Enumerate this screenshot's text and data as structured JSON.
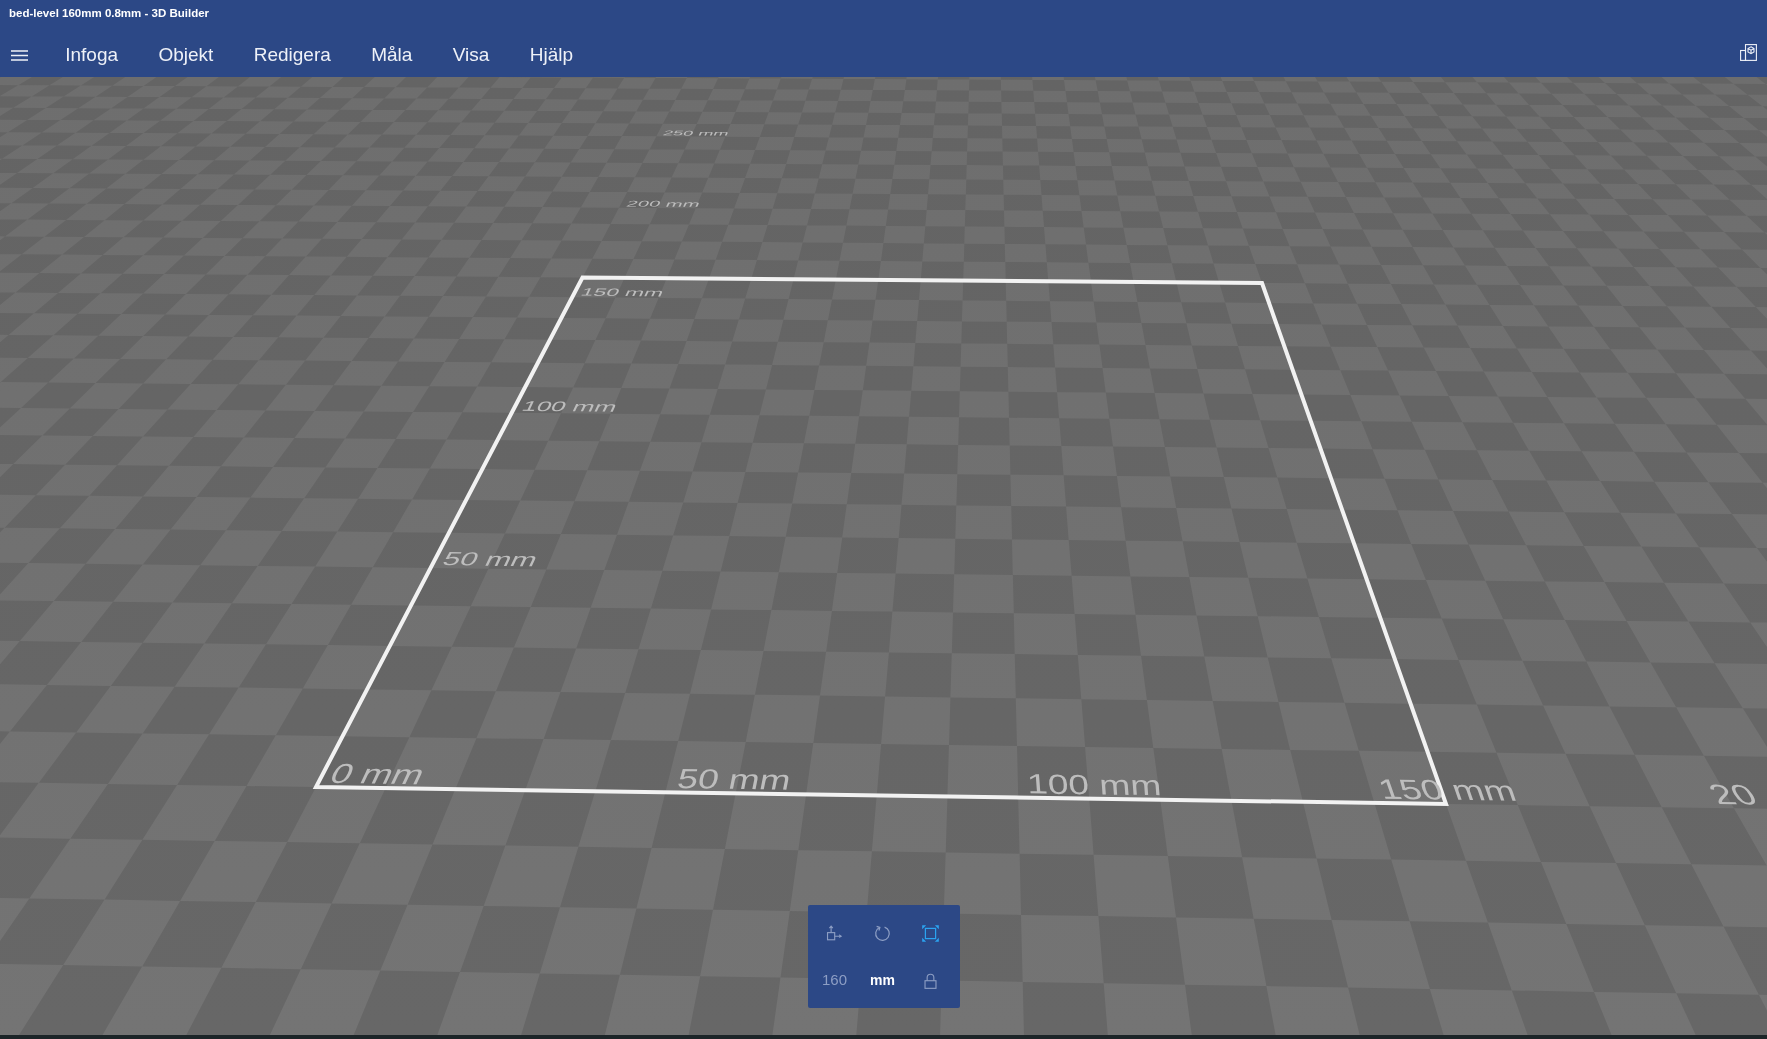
{
  "window": {
    "title": "bed-level 160mm 0.8mm - 3D Builder"
  },
  "menu": {
    "items": [
      "Infoga",
      "Objekt",
      "Redigera",
      "Måla",
      "Visa",
      "Hjälp"
    ]
  },
  "viewport": {
    "x_axis_labels": [
      "0 mm",
      "50 mm",
      "100 mm",
      "150 mm",
      "20"
    ],
    "y_axis_labels": [
      "50 mm",
      "100 mm",
      "150 mm",
      "200 mm",
      "250 mm"
    ]
  },
  "transform_panel": {
    "tools": [
      {
        "kind": "move",
        "selected": false
      },
      {
        "kind": "rotate",
        "selected": false
      },
      {
        "kind": "scale",
        "selected": true
      }
    ],
    "size_field": {
      "value": "160",
      "disabled": true
    },
    "unit": "mm"
  }
}
